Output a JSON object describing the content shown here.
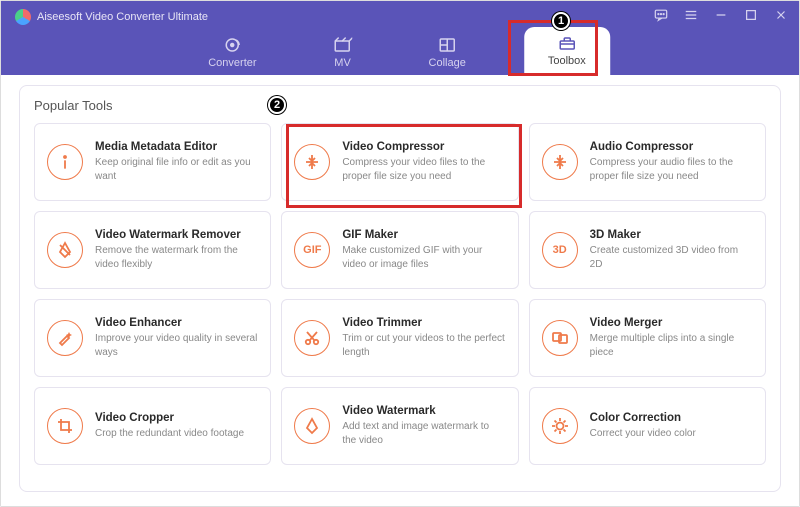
{
  "app": {
    "title": "Aiseesoft Video Converter Ultimate"
  },
  "nav": {
    "tabs": [
      {
        "label": "Converter"
      },
      {
        "label": "MV"
      },
      {
        "label": "Collage"
      },
      {
        "label": "Toolbox"
      }
    ]
  },
  "panel": {
    "title": "Popular Tools"
  },
  "tools": [
    {
      "title": "Media Metadata Editor",
      "desc": "Keep original file info or edit as you want"
    },
    {
      "title": "Video Compressor",
      "desc": "Compress your video files to the proper file size you need"
    },
    {
      "title": "Audio Compressor",
      "desc": "Compress your audio files to the proper file size you need"
    },
    {
      "title": "Video Watermark Remover",
      "desc": "Remove the watermark from the video flexibly"
    },
    {
      "title": "GIF Maker",
      "desc": "Make customized GIF with your video or image files"
    },
    {
      "title": "3D Maker",
      "desc": "Create customized 3D video from 2D"
    },
    {
      "title": "Video Enhancer",
      "desc": "Improve your video quality in several ways"
    },
    {
      "title": "Video Trimmer",
      "desc": "Trim or cut your videos to the perfect length"
    },
    {
      "title": "Video Merger",
      "desc": "Merge multiple clips into a single piece"
    },
    {
      "title": "Video Cropper",
      "desc": "Crop the redundant video footage"
    },
    {
      "title": "Video Watermark",
      "desc": "Add text and image watermark to the video"
    },
    {
      "title": "Color Correction",
      "desc": "Correct your video color"
    }
  ],
  "annotations": {
    "badge1": "1",
    "badge2": "2"
  }
}
